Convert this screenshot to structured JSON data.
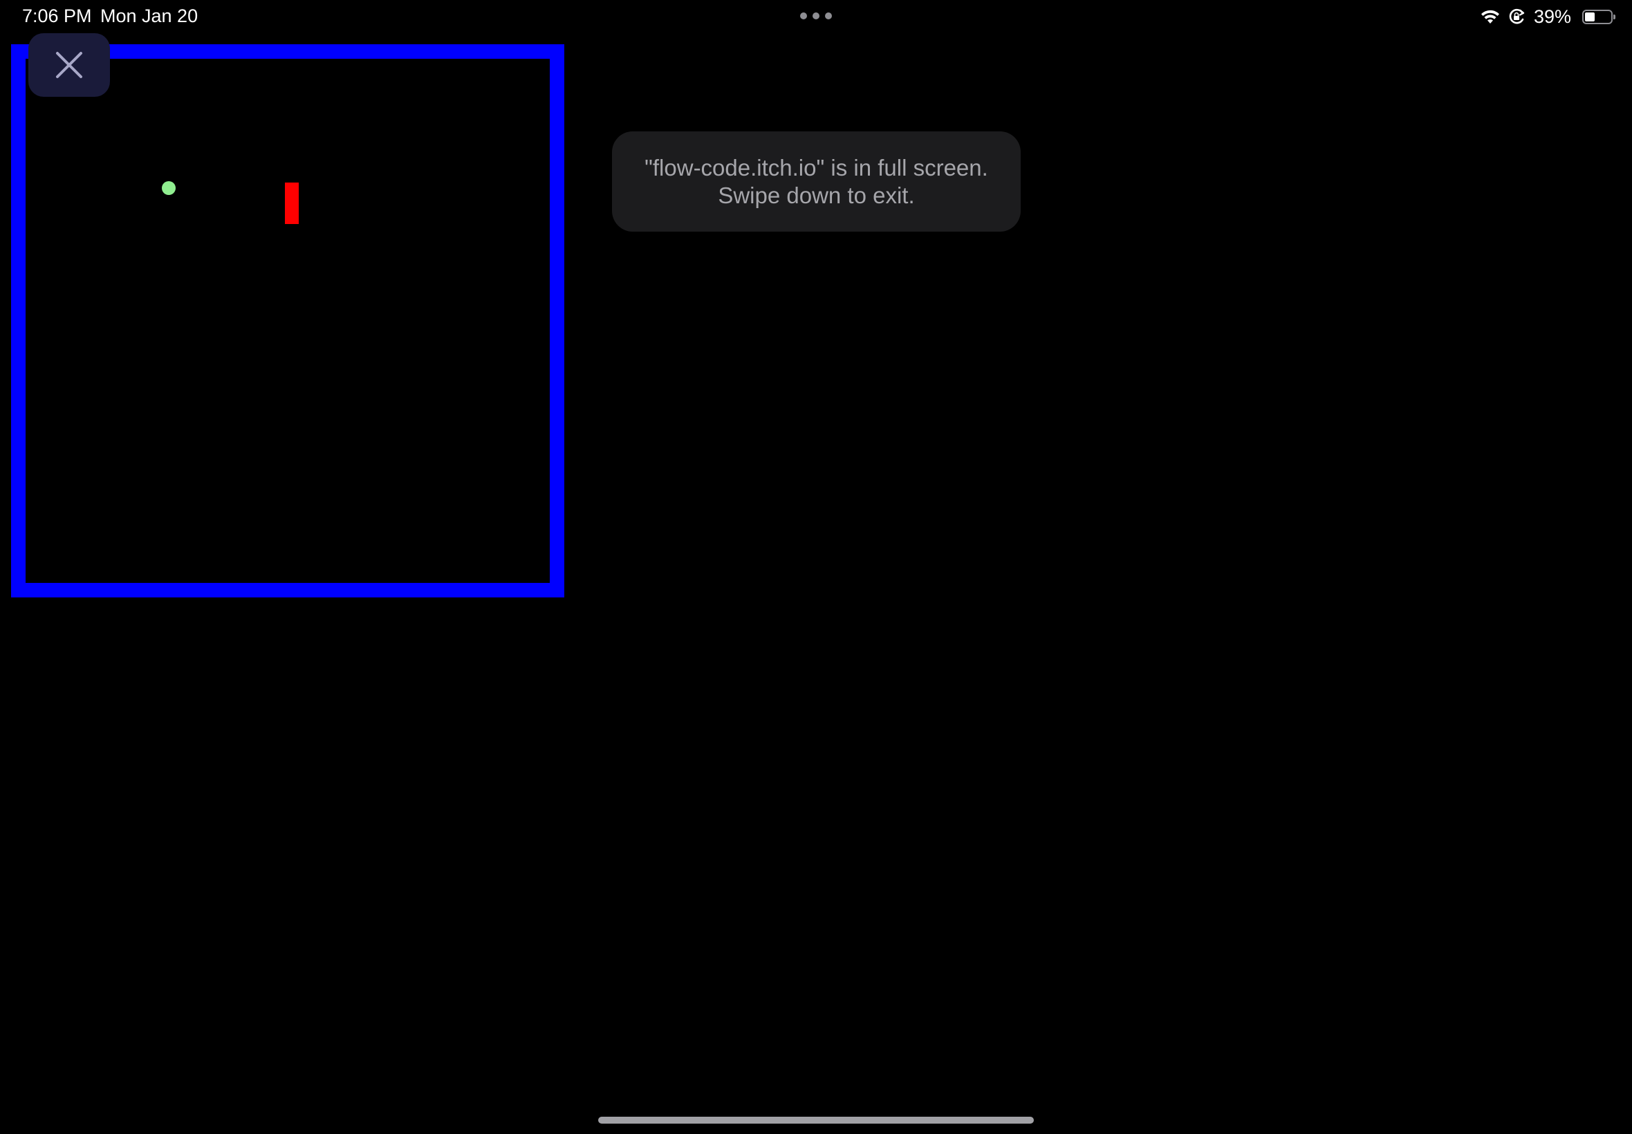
{
  "status_bar": {
    "time": "7:06 PM",
    "date": "Mon Jan 20",
    "battery_percent": "39%",
    "battery_level": 0.39,
    "icons": [
      "wifi-icon",
      "orientation-lock-icon",
      "battery-icon",
      "multitask-dots-icon"
    ]
  },
  "game": {
    "border_color": "#0000ff",
    "ball_color": "#90ee90",
    "paddle_color": "#ff0000"
  },
  "close_button": {
    "icon": "close-icon"
  },
  "fullscreen_notice": {
    "line1": "\"flow-code.itch.io\" is in full screen.",
    "line2": "Swipe down to exit."
  }
}
